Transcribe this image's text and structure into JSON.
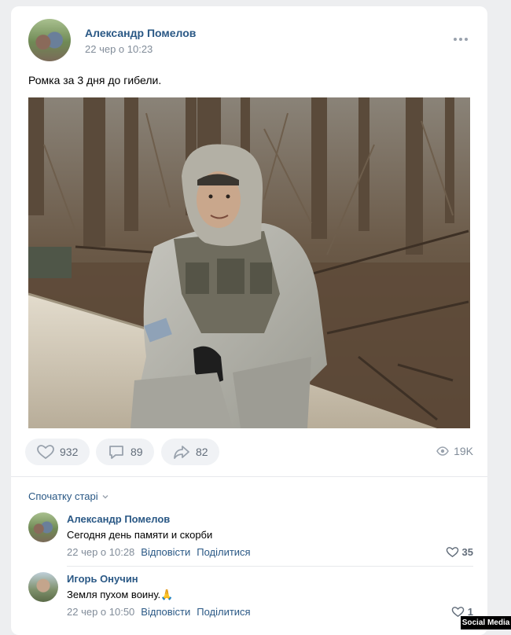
{
  "post": {
    "author": "Александр Помелов",
    "time": "22 чер о 10:23",
    "text": "Ромка за 3 дня до гибели.",
    "photo_alt": "soldier-in-forest-photo"
  },
  "actions": {
    "likes": "932",
    "comments": "89",
    "shares": "82",
    "views": "19K"
  },
  "comments_section": {
    "sort_label": "Спочатку старі",
    "items": [
      {
        "author": "Александр Помелов",
        "text": "Сегодня день памяти и скорби",
        "time": "22 чер о 10:28",
        "reply": "Відповісти",
        "share": "Поділитися",
        "likes": "35"
      },
      {
        "author": "Игорь Онучин",
        "text": "Земля пухом воину.🙏",
        "time": "22 чер о 10:50",
        "reply": "Відповісти",
        "share": "Поділитися",
        "likes": "1"
      }
    ]
  },
  "watermark": "Social Media",
  "colors": {
    "link": "#2a5885",
    "muted": "#818c99",
    "background": "#edeef0"
  }
}
